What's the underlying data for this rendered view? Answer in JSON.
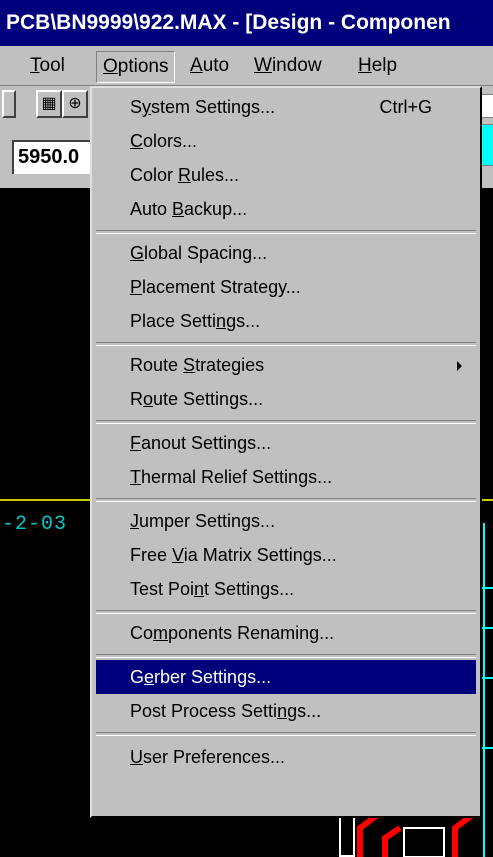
{
  "window": {
    "title": "PCB\\BN9999\\922.MAX - [Design - Componen"
  },
  "menubar": {
    "items": [
      {
        "pre": "",
        "u": "T",
        "post": "ool"
      },
      {
        "pre": "",
        "u": "O",
        "post": "ptions"
      },
      {
        "pre": "",
        "u": "A",
        "post": "uto"
      },
      {
        "pre": "",
        "u": "W",
        "post": "indow"
      },
      {
        "pre": "",
        "u": "H",
        "post": "elp"
      }
    ]
  },
  "coord": {
    "value": "5950.0"
  },
  "canvas": {
    "label": "-2-03"
  },
  "options_menu": {
    "items": [
      {
        "pre": "S",
        "u": "y",
        "post": "stem Settings...",
        "shortcut": "Ctrl+G"
      },
      {
        "pre": "",
        "u": "C",
        "post": "olors..."
      },
      {
        "pre": "Color ",
        "u": "R",
        "post": "ules..."
      },
      {
        "pre": "Auto ",
        "u": "B",
        "post": "ackup..."
      },
      {
        "pre": "",
        "u": "G",
        "post": "lobal Spacing..."
      },
      {
        "pre": "",
        "u": "P",
        "post": "lacement Strategy..."
      },
      {
        "pre": "Place Setti",
        "u": "n",
        "post": "gs..."
      },
      {
        "pre": "Route ",
        "u": "S",
        "post": "trategies"
      },
      {
        "pre": "R",
        "u": "o",
        "post": "ute Settings..."
      },
      {
        "pre": "",
        "u": "F",
        "post": "anout Settings..."
      },
      {
        "pre": "",
        "u": "T",
        "post": "hermal Relief Settings..."
      },
      {
        "pre": "",
        "u": "J",
        "post": "umper Settings..."
      },
      {
        "pre": "Free ",
        "u": "V",
        "post": "ia Matrix Settings..."
      },
      {
        "pre": "Test Poi",
        "u": "n",
        "post": "t Settings..."
      },
      {
        "pre": "Co",
        "u": "m",
        "post": "ponents Renaming..."
      },
      {
        "pre": "G",
        "u": "e",
        "post": "rber Settings..."
      },
      {
        "pre": "Post Process Setti",
        "u": "n",
        "post": "gs..."
      },
      {
        "pre": "",
        "u": "U",
        "post": "ser Preferences..."
      }
    ]
  }
}
